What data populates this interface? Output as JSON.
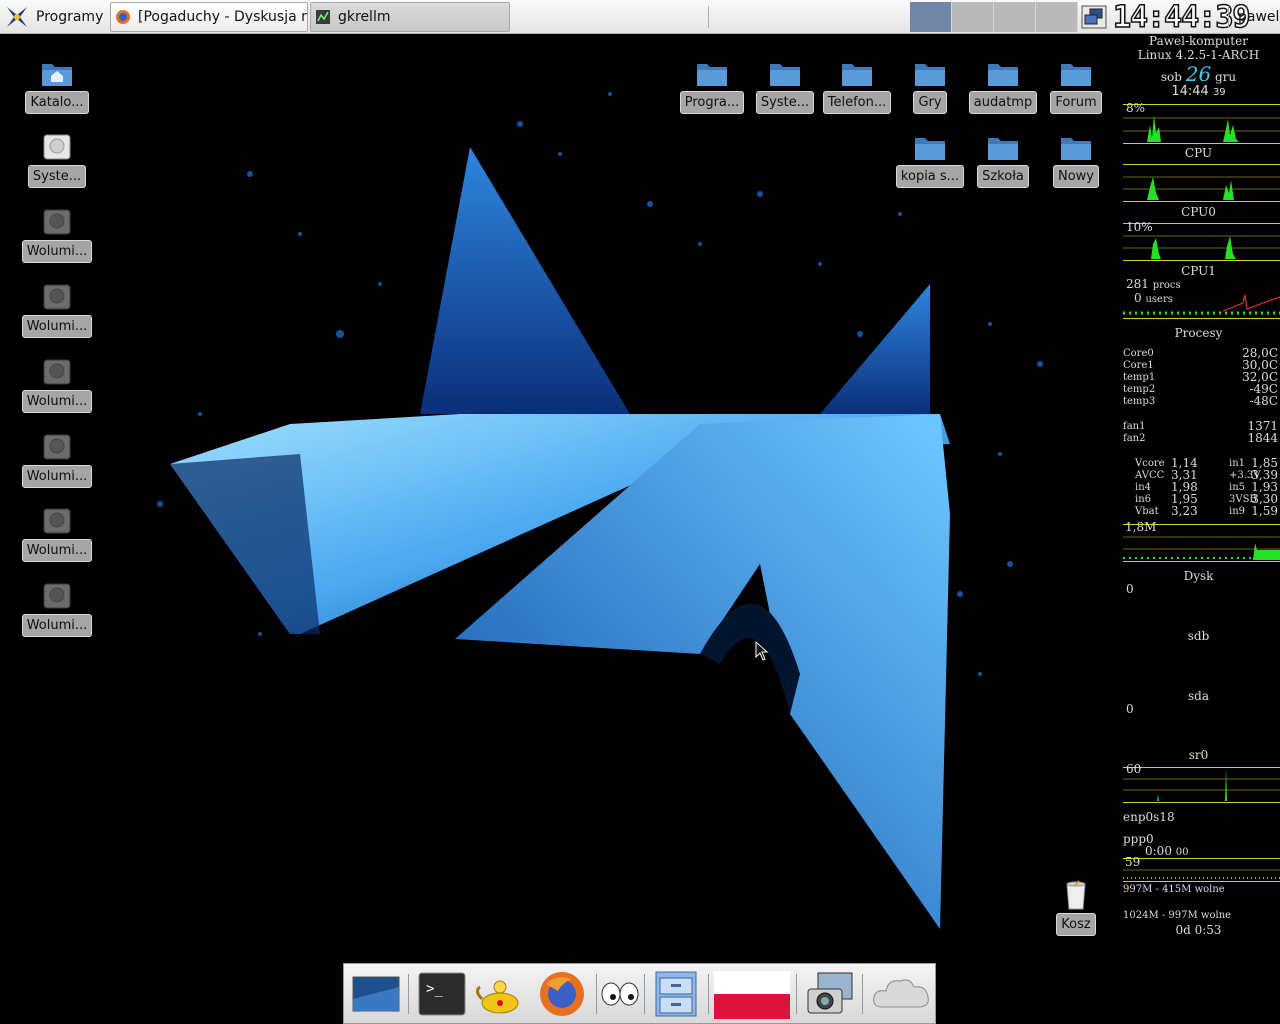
{
  "top_panel": {
    "menu_label": "Programy",
    "tasks": [
      {
        "title": "[Pogaduchy - Dyskusja n..."
      },
      {
        "title": "gkrellm"
      }
    ],
    "workspaces": [
      true,
      false,
      false,
      false
    ],
    "clock": "14:44:39",
    "user": "pawel"
  },
  "desktop_left": [
    {
      "label": "Katalo...",
      "icon": "home-folder-icon"
    },
    {
      "label": "Syste...",
      "icon": "harddisk-icon"
    },
    {
      "label": "Wolumi...",
      "icon": "volume-icon"
    },
    {
      "label": "Wolumi...",
      "icon": "volume-icon"
    },
    {
      "label": "Wolumi...",
      "icon": "volume-icon"
    },
    {
      "label": "Wolumi...",
      "icon": "volume-icon"
    },
    {
      "label": "Wolumi...",
      "icon": "volume-icon"
    },
    {
      "label": "Wolumi...",
      "icon": "volume-icon"
    }
  ],
  "desktop_right_row1": [
    "Progra...",
    "Syste...",
    "Telefon...",
    "Gry",
    "audatmp",
    "Forum"
  ],
  "desktop_right_row2": [
    "kopia s...",
    "Szkoła",
    "Nowy"
  ],
  "trash": {
    "label": "Kosz"
  },
  "gkrellm": {
    "host": "Pawel-komputer",
    "kernel": "Linux 4.2.5-1-ARCH",
    "day": "sob",
    "date_num": "26",
    "month": "gru",
    "time": "14:44",
    "seconds": "39",
    "cpu_pct": "8%",
    "cpu_label": "CPU",
    "cpu0_pct": "10%",
    "cpu0_label": "CPU0",
    "cpu1_label": "CPU1",
    "procs_count": "281",
    "procs_word": "procs",
    "users_count": "0",
    "users_word": "users",
    "procs_label": "Procesy",
    "temps": [
      {
        "name": "Core0",
        "value": "28,0C"
      },
      {
        "name": "Core1",
        "value": "30,0C"
      },
      {
        "name": "temp1",
        "value": "32,0C"
      },
      {
        "name": "temp2",
        "value": "-49C"
      },
      {
        "name": "temp3",
        "value": "-48C"
      }
    ],
    "fans": [
      {
        "name": "fan1",
        "value": "1371"
      },
      {
        "name": "fan2",
        "value": "1844"
      }
    ],
    "volts": [
      {
        "n1": "Vcore",
        "v1": "1,14",
        "n2": "in1",
        "v2": "1,85"
      },
      {
        "n1": "AVCC",
        "v1": "3,31",
        "n2": "+3.3V",
        "v2": "3,39"
      },
      {
        "n1": "in4",
        "v1": "1,98",
        "n2": "in5",
        "v2": "1,93"
      },
      {
        "n1": "in6",
        "v1": "1,95",
        "n2": "3VSB",
        "v2": "3,30"
      },
      {
        "n1": "Vbat",
        "v1": "3,23",
        "n2": "in9",
        "v2": "1,59"
      }
    ],
    "disk_rate": "1,8M",
    "disk_label": "Dysk",
    "sdb_value": "0",
    "sdb_label": "sdb",
    "sda_value": "0",
    "sda_label": "sda",
    "sr0_label": "sr0",
    "sr0_value": "60",
    "net1_label": "enp0s18",
    "net2_label": "ppp0",
    "ppp_time": "0:00",
    "ppp_time_suffix": "00",
    "ppp_value": "59",
    "mem": "997M - 415M wolne",
    "swap": "1024M - 997M wolne",
    "uptime": "0d  0:53"
  },
  "dock": [
    {
      "icon": "show-desktop-icon"
    },
    {
      "icon": "terminal-icon"
    },
    {
      "icon": "genie-lamp-icon"
    },
    {
      "icon": "firefox-icon"
    },
    {
      "icon": "eyes-icon"
    },
    {
      "icon": "file-cabinet-icon"
    },
    {
      "icon": "polish-flag-icon"
    },
    {
      "icon": "screenshot-camera-icon"
    },
    {
      "icon": "weather-cloud-icon"
    }
  ],
  "colors": {
    "accent_workspace": "#6f86a6",
    "chart_green": "#26e026",
    "chart_border": "#d9d21a",
    "date_cyan": "#3ec9f0"
  }
}
